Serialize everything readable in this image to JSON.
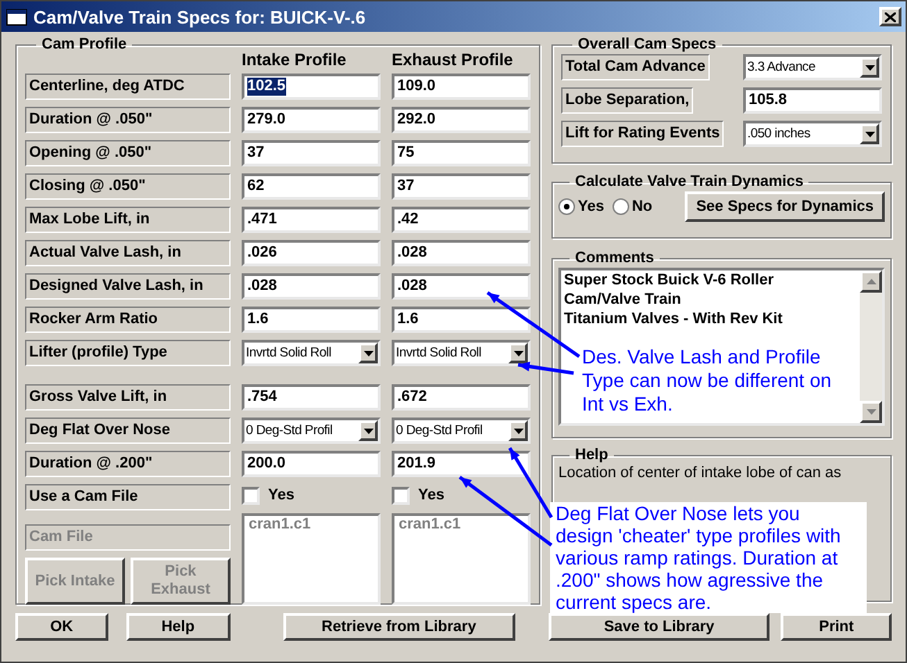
{
  "window": {
    "title": "Cam/Valve Train Specs for: BUICK-V-.6"
  },
  "cam_profile": {
    "title": "Cam Profile",
    "columns": [
      "Intake Profile",
      "Exhaust Profile"
    ],
    "rows": [
      {
        "kind": "text",
        "label": "Centerline, deg ATDC",
        "intake": {
          "value": "102.5",
          "highlighted": true
        },
        "exhaust": {
          "value": "109.0",
          "highlighted": false
        }
      },
      {
        "kind": "text",
        "label": "Duration @ .050\"",
        "intake": {
          "value": "279.0",
          "highlighted": false
        },
        "exhaust": {
          "value": "292.0",
          "highlighted": false
        }
      },
      {
        "kind": "text",
        "label": "Opening @ .050\"",
        "intake": {
          "value": "37",
          "highlighted": false
        },
        "exhaust": {
          "value": "75",
          "highlighted": false
        }
      },
      {
        "kind": "text",
        "label": "Closing @ .050\"",
        "intake": {
          "value": "62",
          "highlighted": false
        },
        "exhaust": {
          "value": "37",
          "highlighted": false
        }
      },
      {
        "kind": "text",
        "label": "Max Lobe Lift, in",
        "intake": {
          "value": ".471",
          "highlighted": false
        },
        "exhaust": {
          "value": ".42",
          "highlighted": false
        }
      },
      {
        "kind": "text",
        "label": "Actual Valve Lash, in",
        "intake": {
          "value": ".026",
          "highlighted": false
        },
        "exhaust": {
          "value": ".028",
          "highlighted": false
        }
      },
      {
        "kind": "text",
        "label": "Designed Valve Lash, in",
        "intake": {
          "value": ".028",
          "highlighted": false
        },
        "exhaust": {
          "value": ".028",
          "highlighted": false
        }
      },
      {
        "kind": "text",
        "label": "Rocker Arm Ratio",
        "intake": {
          "value": "1.6",
          "highlighted": false
        },
        "exhaust": {
          "value": "1.6",
          "highlighted": false
        }
      },
      {
        "kind": "combo",
        "label": "Lifter (profile) Type",
        "intake": {
          "value": "Invrtd Solid Roll"
        },
        "exhaust": {
          "value": "Invrtd Solid Roll"
        }
      },
      {
        "kind": "text",
        "label": "Gross Valve Lift, in",
        "intake": {
          "value": ".754",
          "highlighted": false
        },
        "exhaust": {
          "value": ".672",
          "highlighted": false
        }
      },
      {
        "kind": "combo",
        "label": "Deg Flat Over Nose",
        "intake": {
          "value": "0 Deg-Std Profil"
        },
        "exhaust": {
          "value": "0 Deg-Std Profil"
        }
      },
      {
        "kind": "text",
        "label": "Duration @ .200\"",
        "intake": {
          "value": "200.0",
          "highlighted": false
        },
        "exhaust": {
          "value": "201.9",
          "highlighted": false
        }
      },
      {
        "kind": "checkbox",
        "label": "Use a Cam File",
        "intake": {
          "value": "Yes",
          "checked": false
        },
        "exhaust": {
          "value": "Yes",
          "checked": false
        }
      }
    ],
    "cam_file": {
      "label": "Cam File",
      "disabled": true,
      "intake": "cran1.c1",
      "exhaust": "cran1.c1"
    },
    "pick_buttons": [
      {
        "label": "Pick Intake",
        "disabled": true
      },
      {
        "label": "Pick Exhaust",
        "disabled": true
      }
    ]
  },
  "overall": {
    "title": "Overall Cam Specs",
    "rows": [
      {
        "kind": "combo",
        "label": "Total Cam Advance",
        "value": "3.3 Advance"
      },
      {
        "kind": "text",
        "label": "Lobe Separation,",
        "value": "105.8"
      },
      {
        "kind": "combo",
        "label": "Lift for Rating Events",
        "value": ".050 inches"
      }
    ]
  },
  "dynamics": {
    "title": "Calculate Valve Train Dynamics",
    "options": [
      {
        "label": "Yes",
        "selected": true
      },
      {
        "label": "No",
        "selected": false
      }
    ],
    "button": "See Specs for Dynamics"
  },
  "comments": {
    "title": "Comments",
    "lines": [
      "Super Stock Buick V-6 Roller",
      "Cam/Valve Train",
      "Titanium Valves - With Rev Kit"
    ]
  },
  "help": {
    "title": "Help",
    "text": "Location of center of intake lobe of can as"
  },
  "annotations": [
    "Des. Valve Lash and Profile Type can now be different on Int vs Exh.",
    "Deg Flat Over Nose lets you design 'cheater' type profiles with various ramp ratings. Duration at .200\" shows how agressive the current specs are."
  ],
  "buttons": [
    "OK",
    "Help",
    "Retrieve from Library",
    "Save to Library",
    "Print"
  ]
}
